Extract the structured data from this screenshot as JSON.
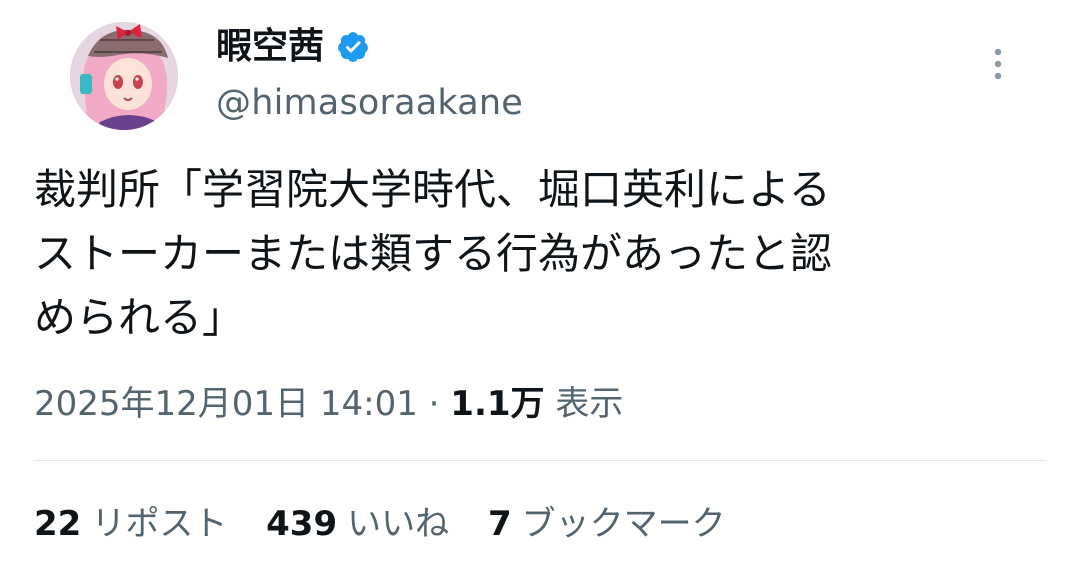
{
  "user": {
    "display_name": "暇空茜",
    "handle": "@himasoraakane",
    "verified": true
  },
  "post": {
    "text": "裁判所「学習院大学時代、堀口英利による\nストーカーまたは類する行為があったと認\nめられる」"
  },
  "meta": {
    "timestamp": "2025年12月01日 14:01",
    "separator": "·",
    "views_count": "1.1万",
    "views_label": "表示"
  },
  "stats": {
    "reposts_count": "22",
    "reposts_label": "リポスト",
    "likes_count": "439",
    "likes_label": "いいね",
    "bookmarks_count": "7",
    "bookmarks_label": "ブックマーク"
  },
  "colors": {
    "primary_text": "#0f1419",
    "secondary_text": "#536471",
    "verified_blue": "#1d9bf0",
    "divider": "#e1e6ea"
  },
  "icons": {
    "verified": "verified-badge-icon",
    "more": "more-vertical-icon"
  }
}
